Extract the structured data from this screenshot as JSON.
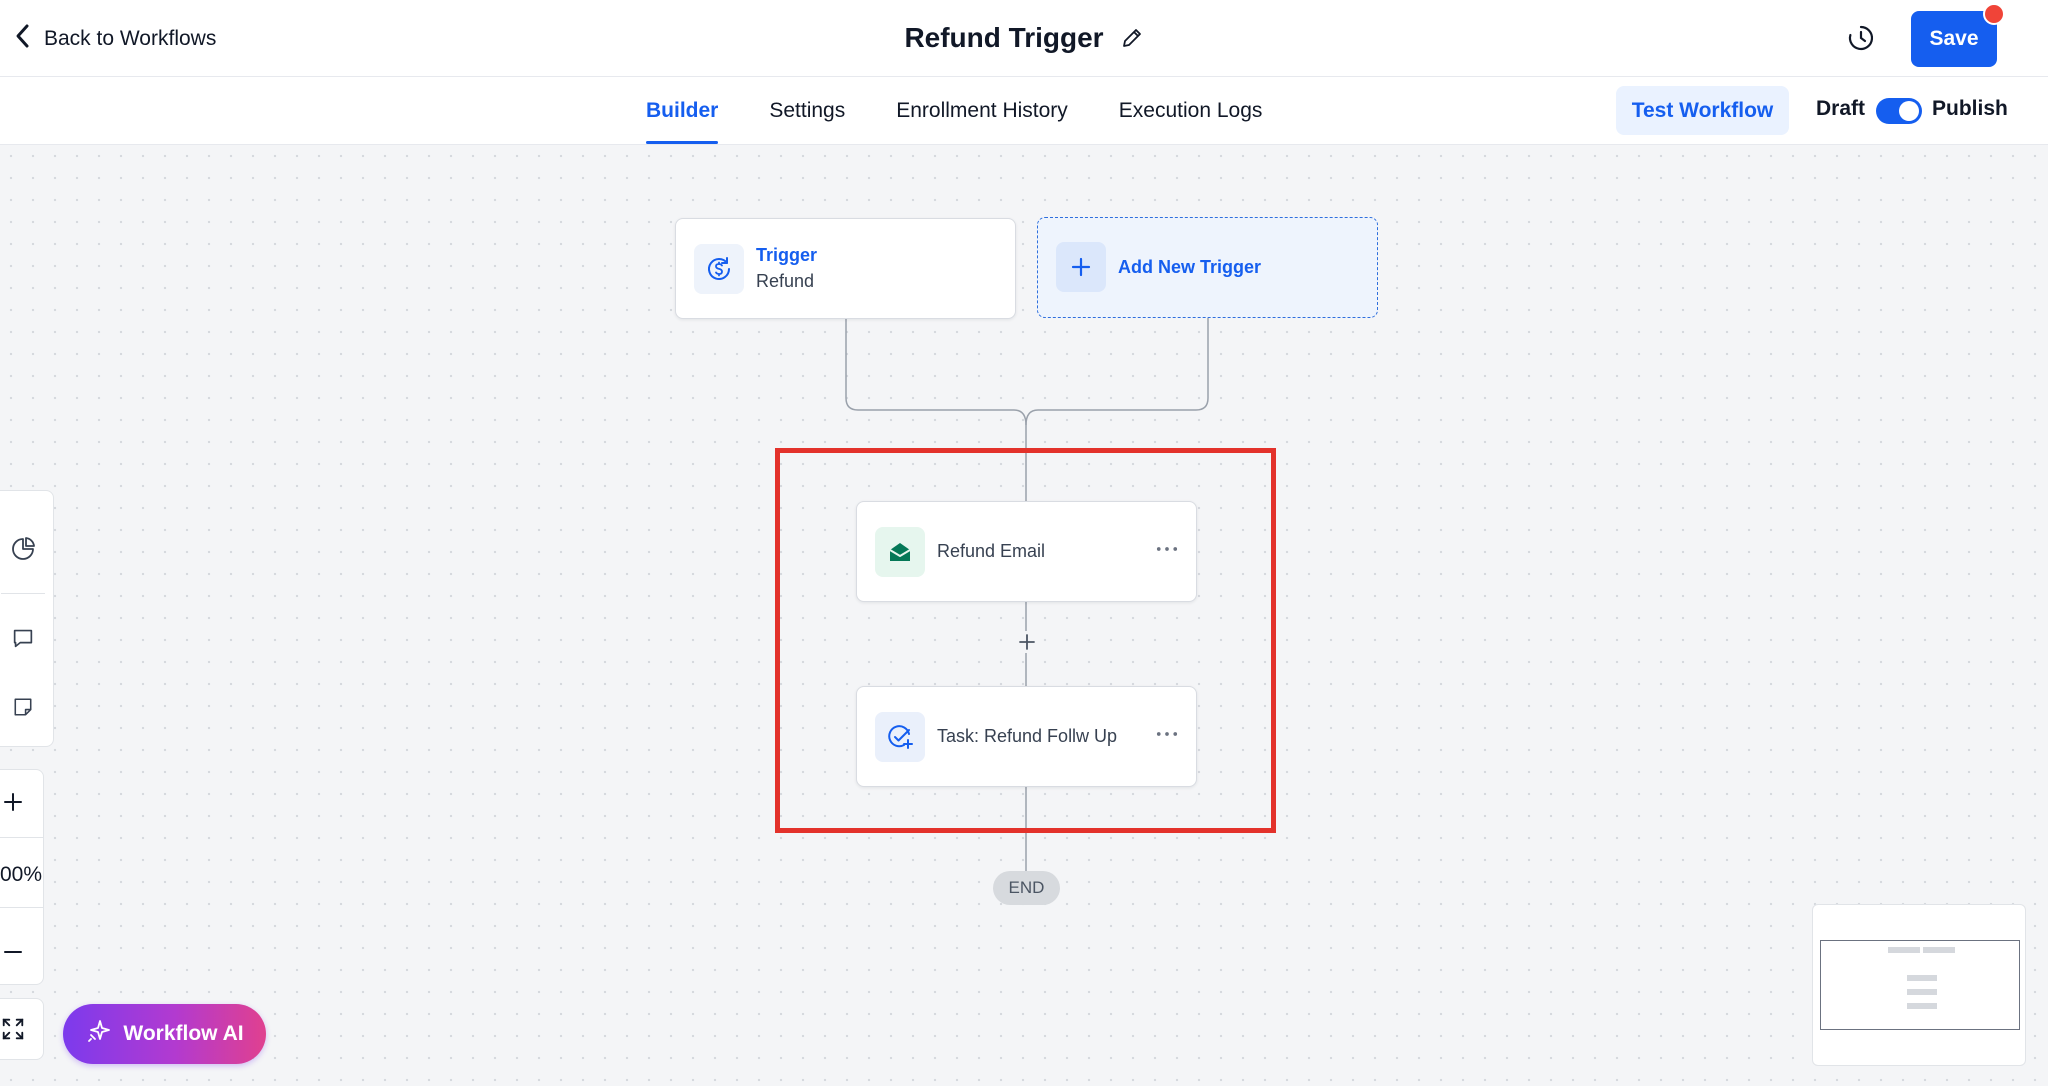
{
  "header": {
    "back_label": "Back to Workflows",
    "title": "Refund Trigger",
    "save_label": "Save"
  },
  "tabs": [
    {
      "label": "Builder",
      "active": true
    },
    {
      "label": "Settings",
      "active": false
    },
    {
      "label": "Enrollment History",
      "active": false
    },
    {
      "label": "Execution Logs",
      "active": false
    }
  ],
  "toolbar": {
    "test_label": "Test Workflow",
    "draft_label": "Draft",
    "publish_label": "Publish",
    "publish_toggle_on": true
  },
  "canvas": {
    "trigger": {
      "title": "Trigger",
      "subtitle": "Refund",
      "icon": "refund-dollar-icon"
    },
    "add_trigger": {
      "label": "Add New Trigger",
      "icon": "plus-icon"
    },
    "actions": [
      {
        "label": "Refund Email",
        "icon": "email-open-icon"
      },
      {
        "label": "Task: Refund Follw Up",
        "icon": "task-check-icon"
      }
    ],
    "end_label": "END",
    "zoom_level": "00%"
  },
  "ai": {
    "label": "Workflow AI",
    "icon": "sparkle-icon"
  },
  "colors": {
    "accent": "#155eef",
    "highlight": "#e3322b",
    "email_green": "#047857",
    "ai_gradient_start": "#7c3aed",
    "ai_gradient_end": "#e0408f"
  }
}
